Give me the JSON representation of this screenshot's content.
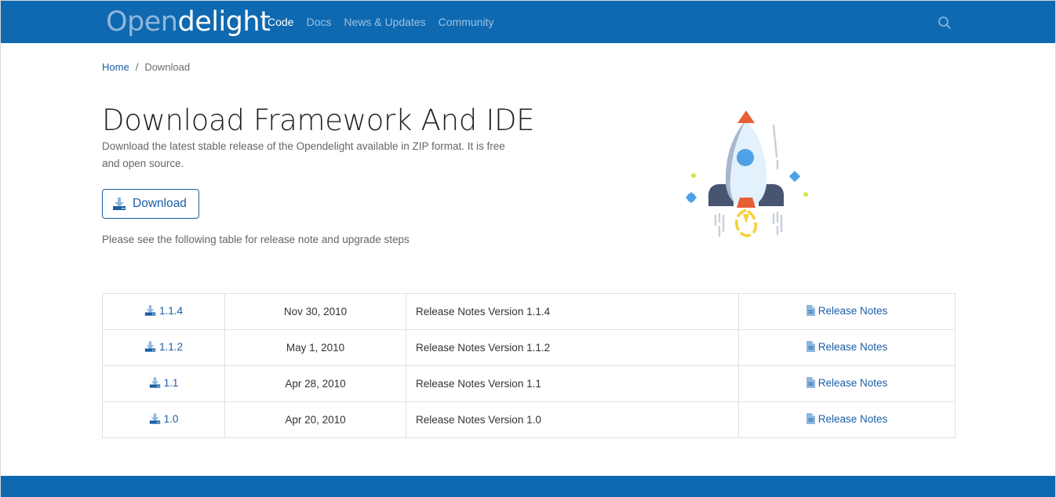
{
  "navbar": {
    "brand_part1": "Open",
    "brand_part2": "delight",
    "links": [
      {
        "label": "Code",
        "active": true
      },
      {
        "label": "Docs",
        "active": false
      },
      {
        "label": "News & Updates",
        "active": false
      },
      {
        "label": "Community",
        "active": false
      }
    ],
    "search_icon": "search-icon",
    "color": "#0f69b0"
  },
  "breadcrumb": {
    "home": "Home",
    "separator": "/",
    "current": "Download"
  },
  "hero": {
    "title": "Download Framework And IDE",
    "description": "Download the latest stable release of the Opendelight available in ZIP format. It is free and open source.",
    "download_button": "Download",
    "note": "Please see the following table for release note and upgrade steps",
    "illustration": "rocket-illustration"
  },
  "releases": [
    {
      "version": "1.1.4",
      "date": "Nov 30, 2010",
      "description": "Release Notes Version 1.1.4",
      "notes_link": "Release Notes"
    },
    {
      "version": "1.1.2",
      "date": "May 1, 2010",
      "description": "Release Notes Version 1.1.2",
      "notes_link": "Release Notes"
    },
    {
      "version": "1.1",
      "date": "Apr 28, 2010",
      "description": "Release Notes Version 1.1",
      "notes_link": "Release Notes"
    },
    {
      "version": "1.0",
      "date": "Apr 20, 2010",
      "description": "Release Notes Version 1.0",
      "notes_link": "Release Notes"
    }
  ],
  "colors": {
    "brand": "#0f69b0",
    "link": "#1a5ea6"
  }
}
